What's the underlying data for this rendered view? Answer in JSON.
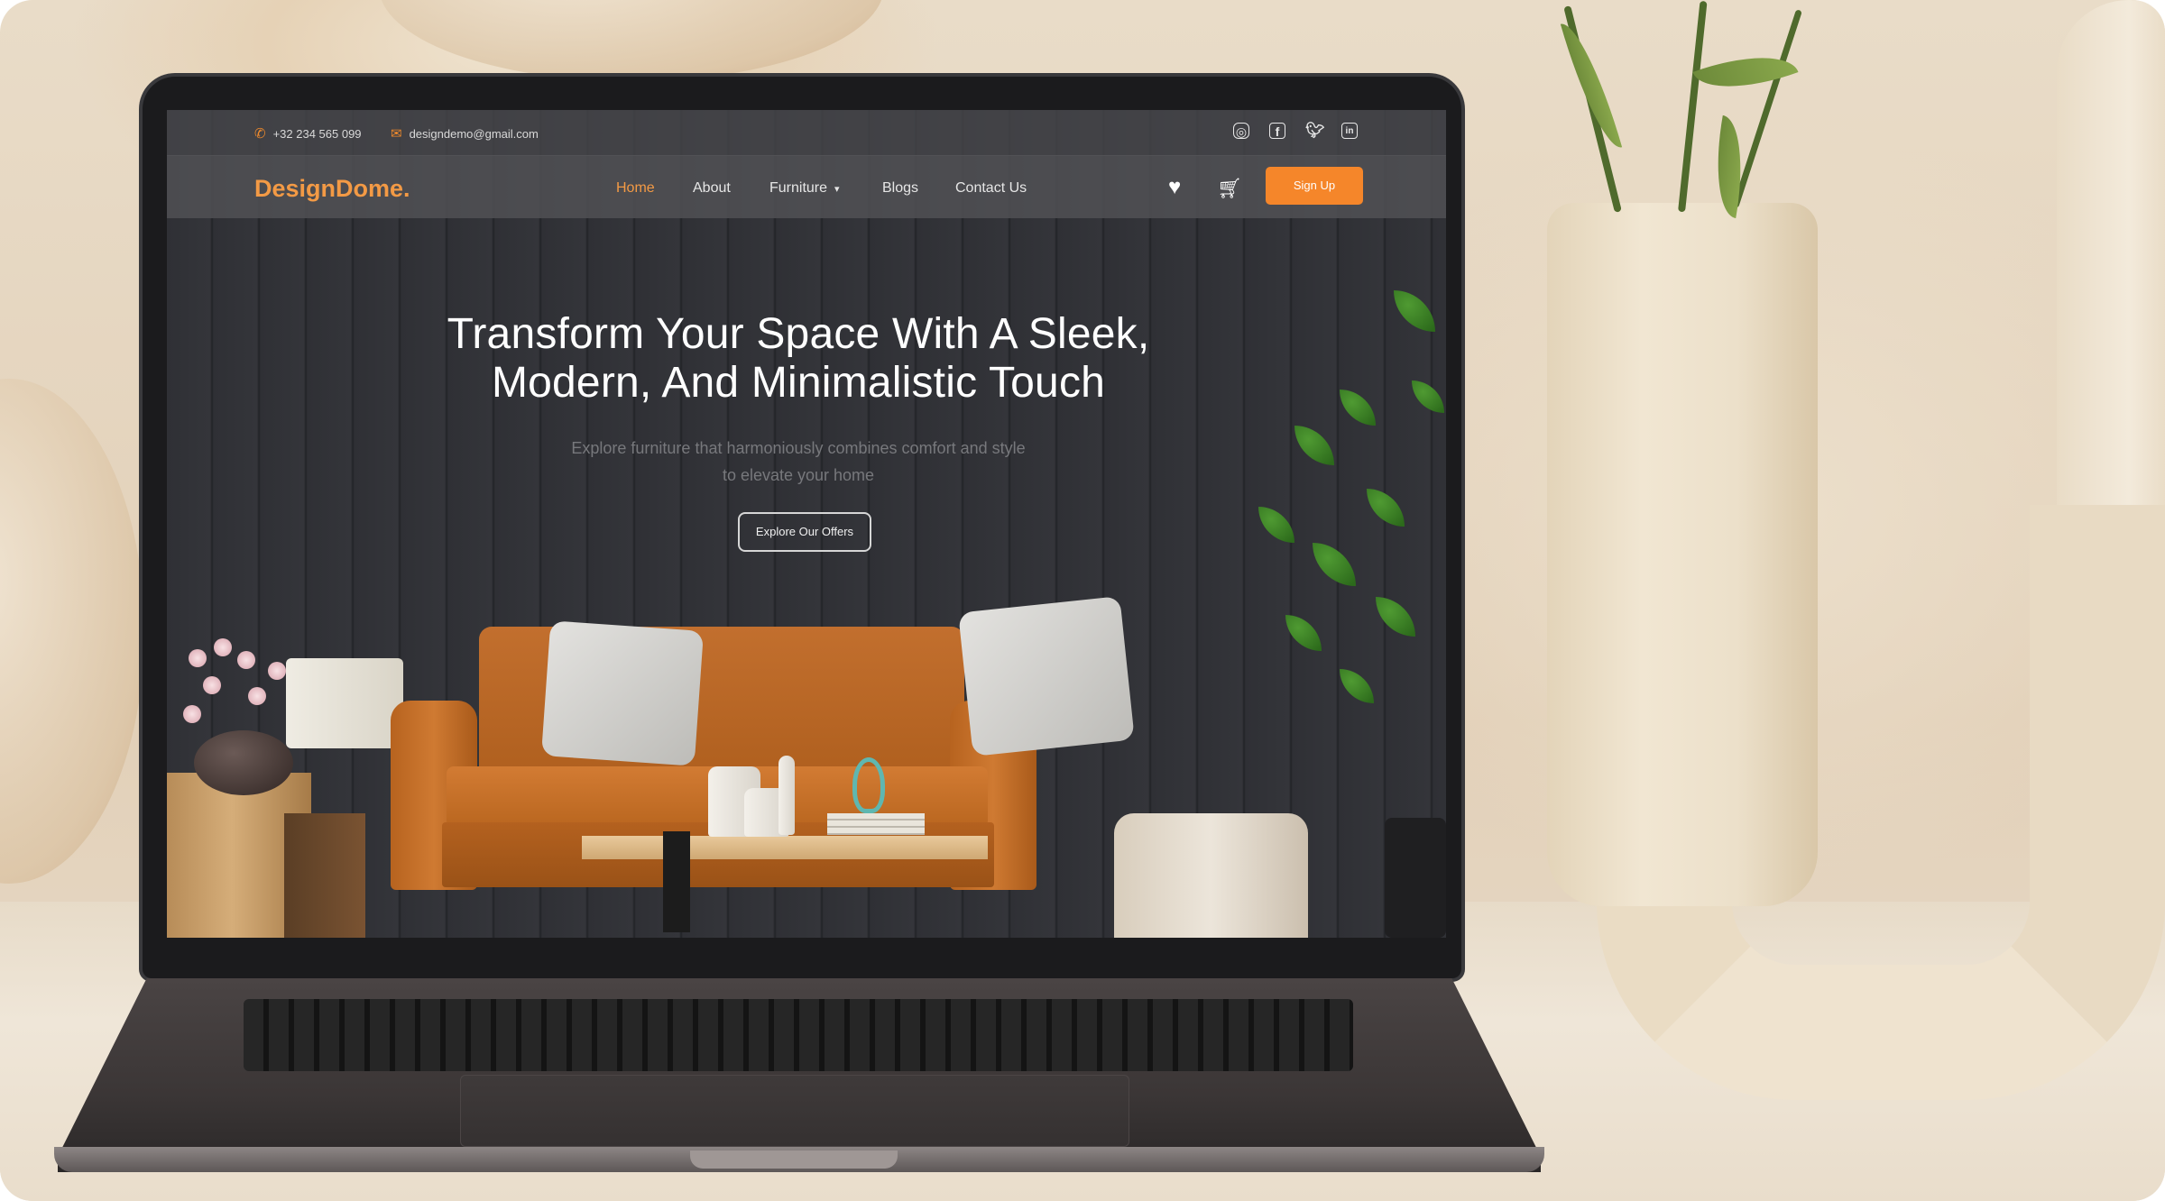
{
  "topbar": {
    "phone": "+32 234 565 099",
    "email": "designdemo@gmail.com"
  },
  "social_icons": [
    "instagram-icon",
    "facebook-icon",
    "twitter-icon",
    "linkedin-icon"
  ],
  "brand": {
    "logo_text": "DesignDome.",
    "accent_color": "#f5862a"
  },
  "nav": {
    "items": [
      "Home",
      "About",
      "Furniture",
      "Blogs",
      "Contact Us"
    ],
    "active": "Home",
    "signup_label": "Sign Up"
  },
  "header_icons": [
    "heart-icon",
    "cart-icon"
  ],
  "hero": {
    "title_line1": "Transform Your Space With A Sleek,",
    "title_line2": "Modern, And Minimalistic Touch",
    "subtitle_line1": "Explore furniture that harmoniously combines comfort and style",
    "subtitle_line2": "to elevate your home",
    "cta_label": "Explore Our Offers"
  }
}
